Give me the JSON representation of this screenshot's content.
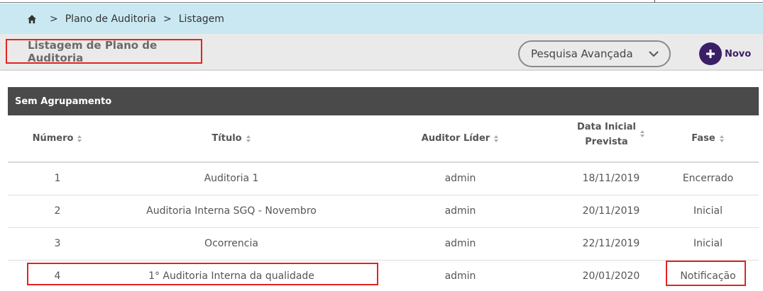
{
  "breadcrumb": {
    "items": [
      "Plano de Auditoria",
      "Listagem"
    ],
    "separator": ">"
  },
  "header": {
    "title": "Listagem de Plano de Auditoria",
    "advanced_search_label": "Pesquisa Avançada",
    "new_button_label": "Novo"
  },
  "group": {
    "label": "Sem Agrupamento"
  },
  "table": {
    "columns": {
      "numero": "Número",
      "titulo": "Título",
      "auditor": "Auditor Líder",
      "data_line1": "Data Inicial",
      "data_line2": "Prevista",
      "fase": "Fase"
    },
    "rows": [
      {
        "numero": "1",
        "titulo": "Auditoria 1",
        "auditor": "admin",
        "data": "18/11/2019",
        "fase": "Encerrado"
      },
      {
        "numero": "2",
        "titulo": "Auditoria Interna SGQ - Novembro",
        "auditor": "admin",
        "data": "20/11/2019",
        "fase": "Inicial"
      },
      {
        "numero": "3",
        "titulo": "Ocorrencia",
        "auditor": "admin",
        "data": "22/11/2019",
        "fase": "Inicial"
      },
      {
        "numero": "4",
        "titulo": "1° Auditoria Interna da qualidade",
        "auditor": "admin",
        "data": "20/01/2020",
        "fase": "Notificação"
      }
    ]
  },
  "icons": {
    "home": "home-icon",
    "chevron": "chevron-down-icon",
    "plus": "plus-icon",
    "sort": "sort-icon"
  },
  "colors": {
    "breadcrumb_bg": "#c9e8f2",
    "group_header_bg": "#4a4a4a",
    "accent": "#3b1f66",
    "highlight": "#e52222"
  }
}
